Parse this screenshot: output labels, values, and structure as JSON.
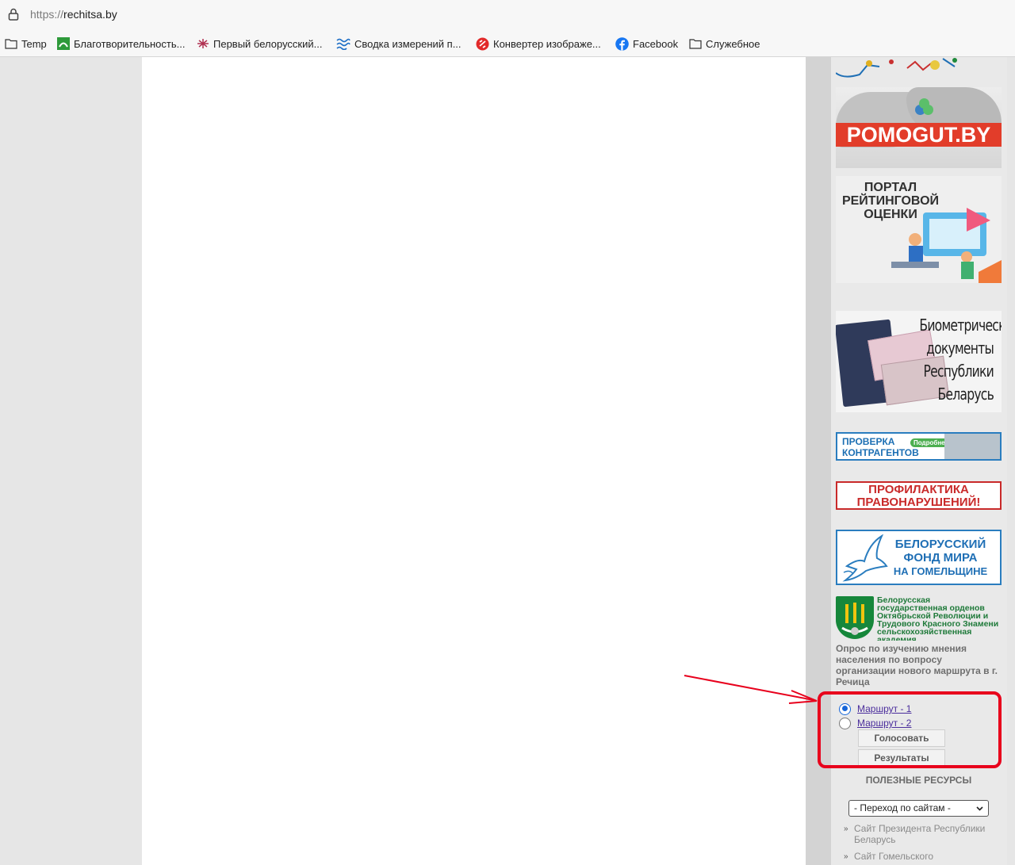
{
  "browser": {
    "url_scheme": "https://",
    "url_host": "rechitsa.by",
    "bookmarks": [
      {
        "label": "Temp",
        "icon": "folder-icon"
      },
      {
        "label": "Благотворительность...",
        "icon": "charity-favicon"
      },
      {
        "label": "Первый белорусский...",
        "icon": "first-belarusian-favicon"
      },
      {
        "label": "Сводка измерений п...",
        "icon": "measurements-favicon"
      },
      {
        "label": "Конвертер изображе...",
        "icon": "converter-favicon"
      },
      {
        "label": "Facebook",
        "icon": "facebook-icon"
      },
      {
        "label": "Служебное",
        "icon": "folder-icon"
      }
    ]
  },
  "sidebar": {
    "banners": {
      "pomogut": "POMOGUT.BY",
      "rating_title": "ПОРТАЛ РЕЙТИНГОВОЙ ОЦЕНКИ",
      "biometric": [
        "Биометрические",
        "документы",
        "Республики",
        "Беларусь"
      ],
      "proverka": [
        "ПРОВЕРКА",
        "КОНТРАГЕНТОВ"
      ],
      "proverka_pill": "Подробнее",
      "profilaktika": [
        "ПРОФИЛАКТИКА",
        "ПРАВОНАРУШЕНИЙ!"
      ],
      "fond": [
        "БЕЛОРУССКИЙ",
        "ФОНД МИРА",
        "НА ГОМЕЛЬЩИНЕ"
      ],
      "academy": "Белорусская государственная орденов Октябрьской Революции и Трудового Красного Знамени сельскохозяйственная академия"
    },
    "poll": {
      "question": "Опрос по изучению мнения населения по вопросу организации нового маршрута в г. Речица",
      "options": [
        {
          "label": "Маршрут - 1",
          "selected": true
        },
        {
          "label": "Маршрут - 2",
          "selected": false
        }
      ],
      "vote_label": "Голосовать",
      "results_label": "Результаты"
    },
    "useful": {
      "heading": "ПОЛЕЗНЫЕ РЕСУРСЫ",
      "select_value": "- Переход по сайтам -",
      "links": [
        "Сайт Президента Республики Беларусь",
        "Сайт Гомельского"
      ]
    }
  },
  "colors": {
    "annotation": "#e8001c",
    "link": "#4b2e9c",
    "radio_selected": "#1565d8"
  }
}
